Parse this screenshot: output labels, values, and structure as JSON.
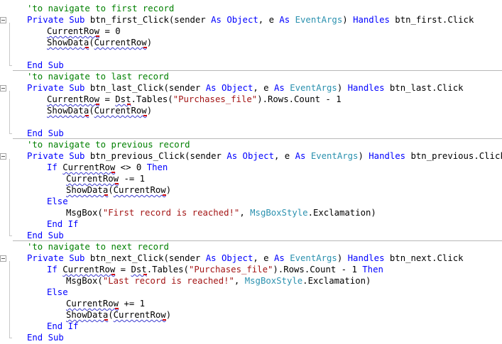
{
  "editor": {
    "language": "vb.net",
    "colors": {
      "comment": "#008000",
      "keyword": "#0000ff",
      "type": "#2b91af",
      "string": "#a31515",
      "text": "#000000",
      "squiggle": "#3a3ad0",
      "error_mark": "#d01010",
      "separator": "#b8b8b8"
    },
    "icons": [
      "collapse-minus-icon"
    ],
    "lines": [
      {
        "indent": 0,
        "tokens": [
          {
            "t": "comment",
            "v": "'to navigate to first record"
          }
        ]
      },
      {
        "indent": 0,
        "collapse": true,
        "tokens": [
          {
            "t": "keyword",
            "v": "Private Sub"
          },
          {
            "t": "text",
            "v": " btn_first_Click(sender "
          },
          {
            "t": "keyword",
            "v": "As"
          },
          {
            "t": "text",
            "v": " "
          },
          {
            "t": "keyword",
            "v": "Object"
          },
          {
            "t": "text",
            "v": ", e "
          },
          {
            "t": "keyword",
            "v": "As"
          },
          {
            "t": "text",
            "v": " "
          },
          {
            "t": "type",
            "v": "EventArgs"
          },
          {
            "t": "text",
            "v": ") "
          },
          {
            "t": "keyword",
            "v": "Handles"
          },
          {
            "t": "text",
            "v": " btn_first.Click"
          }
        ]
      },
      {
        "indent": 1,
        "tokens": [
          {
            "t": "text",
            "v": "CurrentRow",
            "sq": true,
            "mk": true
          },
          {
            "t": "text",
            "v": " = 0"
          }
        ]
      },
      {
        "indent": 1,
        "tokens": [
          {
            "t": "text",
            "v": "ShowData",
            "sq": true,
            "mk": true
          },
          {
            "t": "text",
            "v": "("
          },
          {
            "t": "text",
            "v": "CurrentRow",
            "sq": true,
            "mk": true
          },
          {
            "t": "text",
            "v": ")"
          }
        ]
      },
      {
        "indent": 0,
        "tokens": []
      },
      {
        "indent": 0,
        "tokens": [
          {
            "t": "keyword",
            "v": "End Sub"
          }
        ]
      },
      {
        "indent": 0,
        "sep": true,
        "tokens": [
          {
            "t": "comment",
            "v": "'to navigate to last record"
          }
        ]
      },
      {
        "indent": 0,
        "collapse": true,
        "tokens": [
          {
            "t": "keyword",
            "v": "Private Sub"
          },
          {
            "t": "text",
            "v": " btn_last_Click(sender "
          },
          {
            "t": "keyword",
            "v": "As"
          },
          {
            "t": "text",
            "v": " "
          },
          {
            "t": "keyword",
            "v": "Object"
          },
          {
            "t": "text",
            "v": ", e "
          },
          {
            "t": "keyword",
            "v": "As"
          },
          {
            "t": "text",
            "v": " "
          },
          {
            "t": "type",
            "v": "EventArgs"
          },
          {
            "t": "text",
            "v": ") "
          },
          {
            "t": "keyword",
            "v": "Handles"
          },
          {
            "t": "text",
            "v": " btn_last.Click"
          }
        ]
      },
      {
        "indent": 1,
        "tokens": [
          {
            "t": "text",
            "v": "CurrentRow",
            "sq": true,
            "mk": true
          },
          {
            "t": "text",
            "v": " = "
          },
          {
            "t": "text",
            "v": "Dst",
            "sq": true,
            "mk": true
          },
          {
            "t": "text",
            "v": ".Tables("
          },
          {
            "t": "string",
            "v": "\"Purchases_file\""
          },
          {
            "t": "text",
            "v": ").Rows.Count - 1"
          }
        ]
      },
      {
        "indent": 1,
        "tokens": [
          {
            "t": "text",
            "v": "ShowData",
            "sq": true,
            "mk": true
          },
          {
            "t": "text",
            "v": "("
          },
          {
            "t": "text",
            "v": "CurrentRow",
            "sq": true,
            "mk": true
          },
          {
            "t": "text",
            "v": ")"
          }
        ]
      },
      {
        "indent": 0,
        "tokens": []
      },
      {
        "indent": 0,
        "tokens": [
          {
            "t": "keyword",
            "v": "End Sub"
          }
        ]
      },
      {
        "indent": 0,
        "sep": true,
        "tokens": [
          {
            "t": "comment",
            "v": "'to navigate to previous record"
          }
        ]
      },
      {
        "indent": 0,
        "collapse": true,
        "tokens": [
          {
            "t": "keyword",
            "v": "Private Sub"
          },
          {
            "t": "text",
            "v": " btn_previous_Click(sender "
          },
          {
            "t": "keyword",
            "v": "As"
          },
          {
            "t": "text",
            "v": " "
          },
          {
            "t": "keyword",
            "v": "Object"
          },
          {
            "t": "text",
            "v": ", e "
          },
          {
            "t": "keyword",
            "v": "As"
          },
          {
            "t": "text",
            "v": " "
          },
          {
            "t": "type",
            "v": "EventArgs"
          },
          {
            "t": "text",
            "v": ") "
          },
          {
            "t": "keyword",
            "v": "Handles"
          },
          {
            "t": "text",
            "v": " btn_previous.Click"
          }
        ]
      },
      {
        "indent": 1,
        "tokens": [
          {
            "t": "keyword",
            "v": "If"
          },
          {
            "t": "text",
            "v": " "
          },
          {
            "t": "text",
            "v": "CurrentRow",
            "sq": true,
            "mk": true
          },
          {
            "t": "text",
            "v": " <> 0 "
          },
          {
            "t": "keyword",
            "v": "Then"
          }
        ]
      },
      {
        "indent": 2,
        "tokens": [
          {
            "t": "text",
            "v": "CurrentRow",
            "sq": true,
            "mk": true
          },
          {
            "t": "text",
            "v": " -= 1"
          }
        ]
      },
      {
        "indent": 2,
        "tokens": [
          {
            "t": "text",
            "v": "ShowData",
            "sq": true,
            "mk": true
          },
          {
            "t": "text",
            "v": "("
          },
          {
            "t": "text",
            "v": "CurrentRow",
            "sq": true,
            "mk": true
          },
          {
            "t": "text",
            "v": ")"
          }
        ]
      },
      {
        "indent": 1,
        "tokens": [
          {
            "t": "keyword",
            "v": "Else"
          }
        ]
      },
      {
        "indent": 2,
        "tokens": [
          {
            "t": "text",
            "v": "MsgBox("
          },
          {
            "t": "string",
            "v": "\"First record is reached!\""
          },
          {
            "t": "text",
            "v": ", "
          },
          {
            "t": "type",
            "v": "MsgBoxStyle"
          },
          {
            "t": "text",
            "v": ".Exclamation)"
          }
        ]
      },
      {
        "indent": 1,
        "tokens": [
          {
            "t": "keyword",
            "v": "End If"
          }
        ]
      },
      {
        "indent": 0,
        "tokens": [
          {
            "t": "keyword",
            "v": "End Sub"
          }
        ]
      },
      {
        "indent": 0,
        "sep": true,
        "tokens": [
          {
            "t": "comment",
            "v": "'to navigate to next record"
          }
        ]
      },
      {
        "indent": 0,
        "collapse": true,
        "tokens": [
          {
            "t": "keyword",
            "v": "Private Sub"
          },
          {
            "t": "text",
            "v": " btn_next_Click(sender "
          },
          {
            "t": "keyword",
            "v": "As"
          },
          {
            "t": "text",
            "v": " "
          },
          {
            "t": "keyword",
            "v": "Object"
          },
          {
            "t": "text",
            "v": ", e "
          },
          {
            "t": "keyword",
            "v": "As"
          },
          {
            "t": "text",
            "v": " "
          },
          {
            "t": "type",
            "v": "EventArgs"
          },
          {
            "t": "text",
            "v": ") "
          },
          {
            "t": "keyword",
            "v": "Handles"
          },
          {
            "t": "text",
            "v": " btn_next.Click"
          }
        ]
      },
      {
        "indent": 1,
        "tokens": [
          {
            "t": "keyword",
            "v": "If"
          },
          {
            "t": "text",
            "v": " "
          },
          {
            "t": "text",
            "v": "CurrentRow",
            "sq": true,
            "mk": true
          },
          {
            "t": "text",
            "v": " = "
          },
          {
            "t": "text",
            "v": "Dst",
            "sq": true,
            "mk": true
          },
          {
            "t": "text",
            "v": ".Tables("
          },
          {
            "t": "string",
            "v": "\"Purchases_file\""
          },
          {
            "t": "text",
            "v": ").Rows.Count - 1 "
          },
          {
            "t": "keyword",
            "v": "Then"
          }
        ]
      },
      {
        "indent": 2,
        "tokens": [
          {
            "t": "text",
            "v": "MsgBox("
          },
          {
            "t": "string",
            "v": "\"Last record is reached!\""
          },
          {
            "t": "text",
            "v": ", "
          },
          {
            "t": "type",
            "v": "MsgBoxStyle"
          },
          {
            "t": "text",
            "v": ".Exclamation)"
          }
        ]
      },
      {
        "indent": 1,
        "tokens": [
          {
            "t": "keyword",
            "v": "Else"
          }
        ]
      },
      {
        "indent": 2,
        "tokens": [
          {
            "t": "text",
            "v": "CurrentRow",
            "sq": true,
            "mk": true
          },
          {
            "t": "text",
            "v": " += 1"
          }
        ]
      },
      {
        "indent": 2,
        "tokens": [
          {
            "t": "text",
            "v": "ShowData",
            "sq": true,
            "mk": true
          },
          {
            "t": "text",
            "v": "("
          },
          {
            "t": "text",
            "v": "CurrentRow",
            "sq": true,
            "mk": true
          },
          {
            "t": "text",
            "v": ")"
          }
        ]
      },
      {
        "indent": 1,
        "tokens": [
          {
            "t": "keyword",
            "v": "End If"
          }
        ]
      },
      {
        "indent": 0,
        "tokens": [
          {
            "t": "keyword",
            "v": "End Sub"
          }
        ]
      }
    ]
  }
}
